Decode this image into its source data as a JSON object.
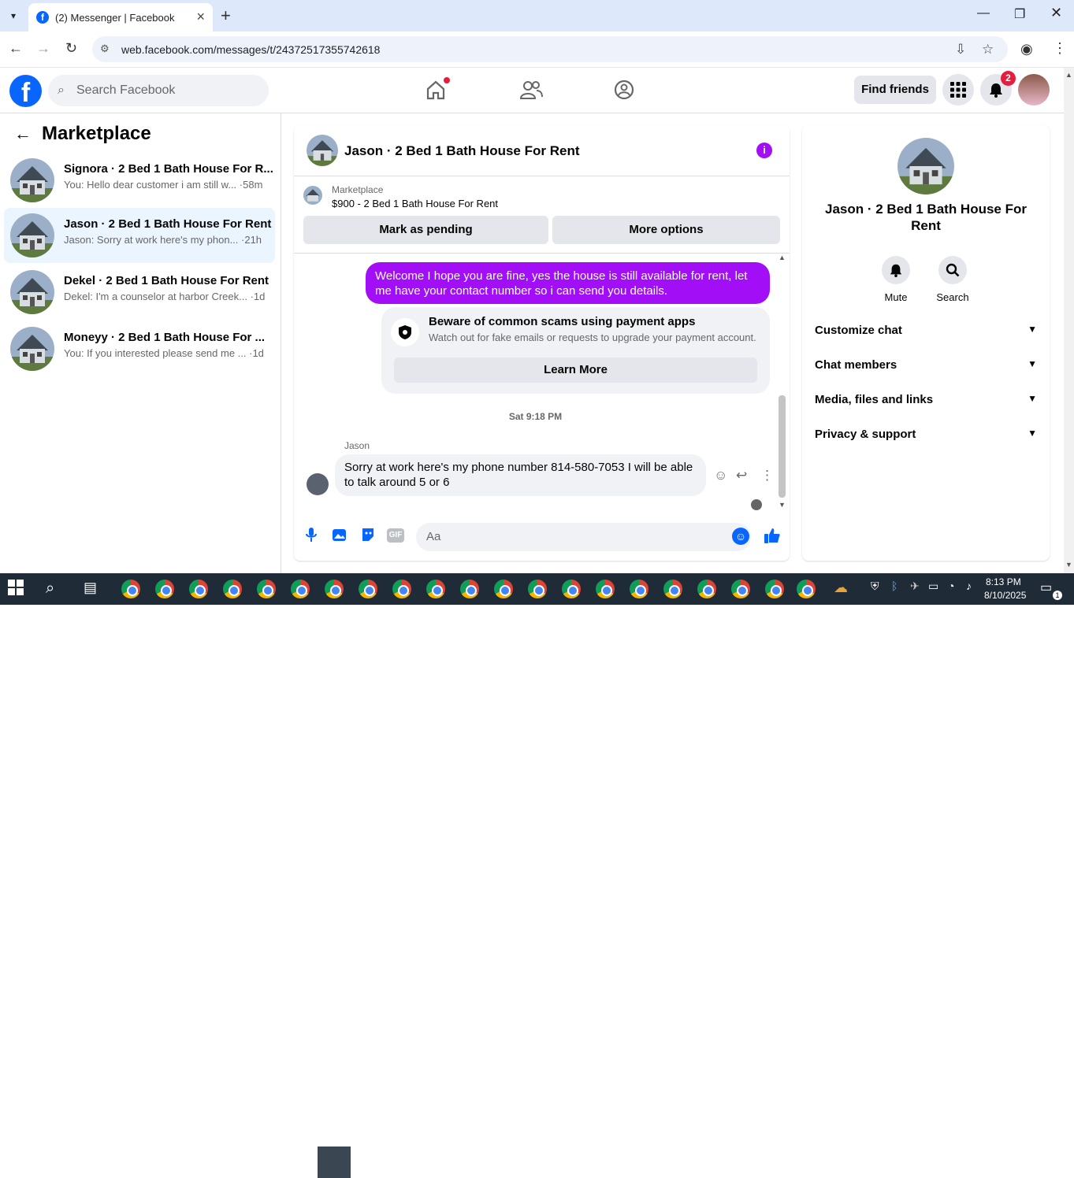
{
  "browser": {
    "tab_title": "(2) Messenger | Facebook",
    "favicon_letter": "f",
    "url": "web.facebook.com/messages/t/24372517355742618"
  },
  "header": {
    "search_placeholder": "Search Facebook",
    "find_friends": "Find friends",
    "notification_count": "2",
    "logo_letter": "f"
  },
  "sidebar": {
    "title": "Marketplace",
    "conversations": [
      {
        "name": "Signora · 2 Bed 1 Bath House For R...",
        "preview": "You: Hello dear customer i am still w... ·58m",
        "active": false
      },
      {
        "name": "Jason · 2 Bed 1 Bath House For Rent",
        "preview": "Jason: Sorry at work here's my phon... ·21h",
        "active": true
      },
      {
        "name": "Dekel · 2 Bed 1 Bath House For Rent",
        "preview": "Dekel: I'm a counselor at harbor Creek... ·1d",
        "active": false
      },
      {
        "name": "Moneyy · 2 Bed 1 Bath House For ...",
        "preview": "You: If you interested please send me ... ·1d",
        "active": false
      }
    ]
  },
  "chat": {
    "title": "Jason · 2 Bed 1 Bath House For Rent",
    "marketplace_label": "Marketplace",
    "listing": "$900 - 2 Bed 1 Bath House For Rent",
    "mark_pending": "Mark as pending",
    "more_options": "More options",
    "outgoing_message": "Welcome I hope you are fine, yes the house is still available for rent, let me have your contact number so i can send you  details.",
    "scam_title": "Beware of common scams using payment apps",
    "scam_text": "Watch out for fake emails or requests to upgrade your payment account.",
    "learn_more": "Learn More",
    "timestamp": "Sat 9:18 PM",
    "sender": "Jason",
    "incoming_message": "Sorry at work here's my phone number 814-580-7053 I will be able to talk around 5 or 6",
    "composer_placeholder": "Aa"
  },
  "right_panel": {
    "name": "Jason · 2 Bed 1 Bath House For Rent",
    "mute": "Mute",
    "search": "Search",
    "sections": [
      "Customize chat",
      "Chat members",
      "Media, files and links",
      "Privacy & support"
    ]
  },
  "taskbar": {
    "time": "8:13 PM",
    "date": "8/10/2025",
    "notif_count": "1"
  },
  "colors": {
    "accent": "#0866ff",
    "outgoing_bubble": "#a20ef5",
    "badge": "#e41e3f"
  }
}
